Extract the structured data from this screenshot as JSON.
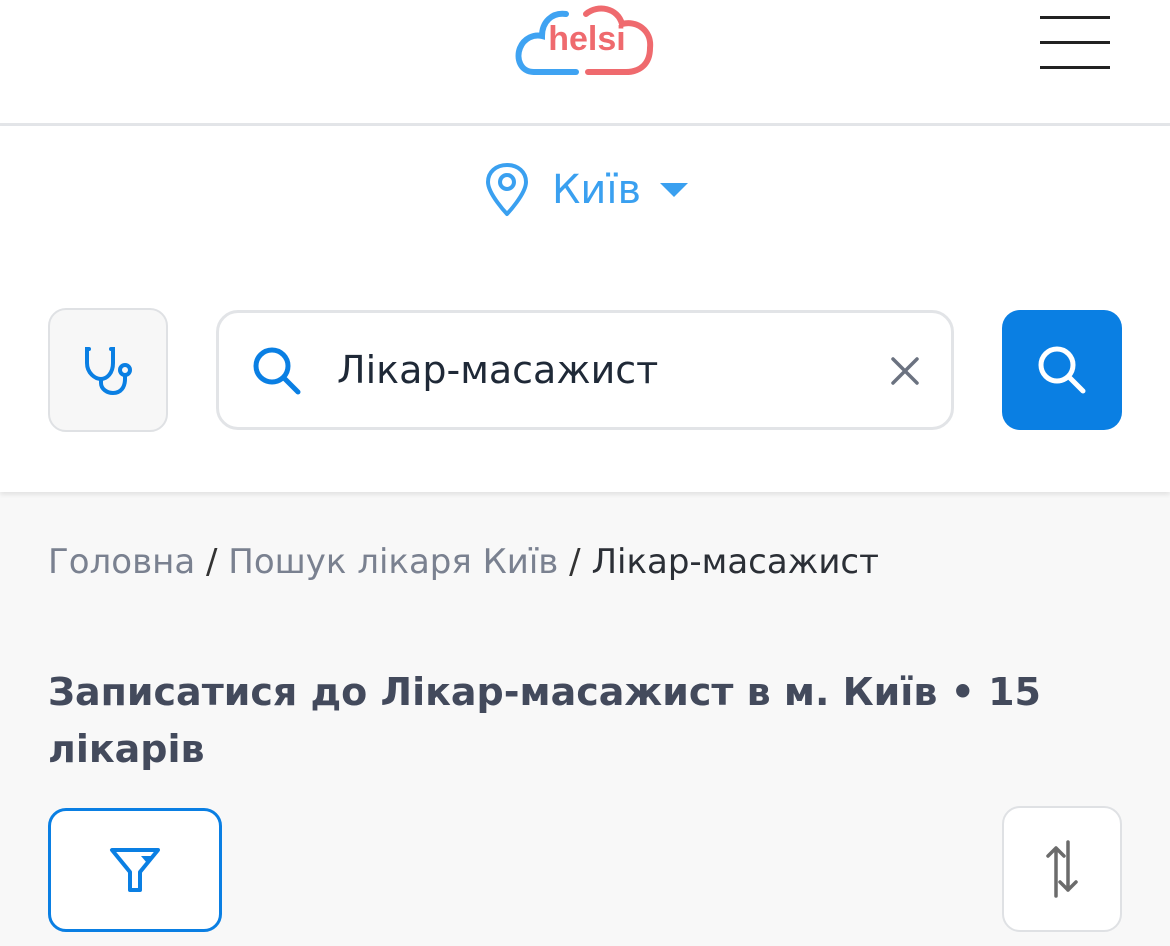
{
  "header": {
    "logo_text": "helsi",
    "menu_icon": "hamburger-menu-icon"
  },
  "location": {
    "city": "Київ",
    "icon": "map-pin-icon"
  },
  "search": {
    "specialty_icon": "stethoscope-icon",
    "search_icon": "search-icon",
    "value": "Лікар-масажист",
    "clear_icon": "close-icon",
    "submit_icon": "search-icon"
  },
  "breadcrumb": {
    "home": "Головна",
    "separator": "/",
    "search": "Пошук лікаря Київ",
    "current": "Лікар-масажист"
  },
  "page": {
    "title": "Записатися до Лікар-масажист в м. Київ • 15 лікарів"
  },
  "toolbar": {
    "filter_icon": "filter-funnel-icon",
    "sort_icon": "sort-arrows-icon"
  },
  "colors": {
    "accent": "#0a7fe3",
    "city": "#3aa0f0",
    "logo_blue": "#3fa3f2",
    "logo_red": "#ef6a6e",
    "title": "#434a5c"
  }
}
